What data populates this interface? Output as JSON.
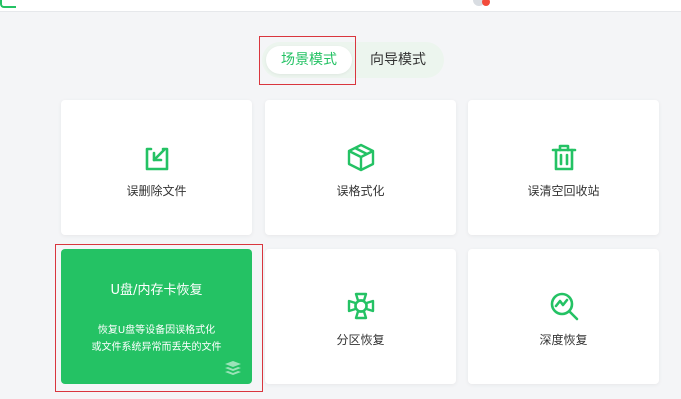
{
  "mode_switch": {
    "tabs": [
      {
        "label": "场景模式",
        "active": true
      },
      {
        "label": "向导模式",
        "active": false
      }
    ]
  },
  "cards": {
    "delete": {
      "label": "误删除文件",
      "icon": "file-restore-icon"
    },
    "format": {
      "label": "误格式化",
      "icon": "cube-icon"
    },
    "recycle": {
      "label": "误清空回收站",
      "icon": "trash-icon"
    },
    "usb": {
      "title": "U盘/内存卡恢复",
      "desc_line1": "恢复U盘等设备因误格式化",
      "desc_line2": "或文件系统异常而丢失的文件",
      "icon": "layers-icon"
    },
    "partition": {
      "label": "分区恢复",
      "icon": "lifebuoy-icon"
    },
    "deep": {
      "label": "深度恢复",
      "icon": "magnifier-chart-icon"
    }
  },
  "colors": {
    "accent": "#24c264",
    "highlight_border": "#d9363e",
    "background": "#f4f5f7"
  }
}
